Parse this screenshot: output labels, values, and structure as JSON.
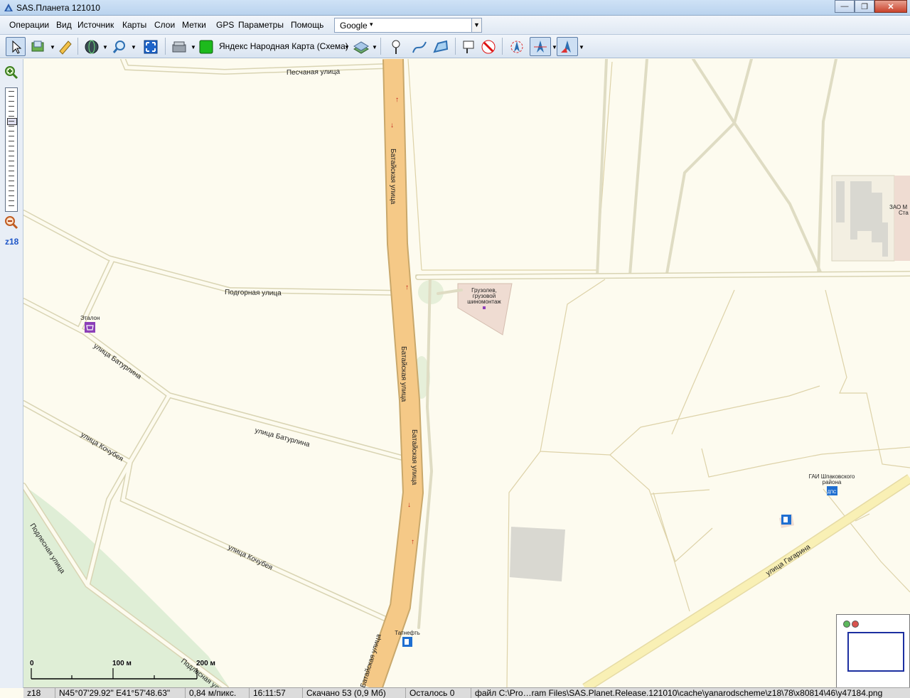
{
  "window": {
    "title": "SAS.Планета 121010",
    "btn_minimize": "—",
    "btn_maximize": "❐",
    "btn_close": "✕"
  },
  "menu": {
    "items": [
      "Операции",
      "Вид",
      "Источник",
      "Карты",
      "Слои",
      "Метки",
      "GPS",
      "Параметры",
      "Помощь"
    ],
    "search_provider": "Google",
    "search_value": ""
  },
  "toolbar": {
    "map_name": "Яндекс Народная Карта (Схема)",
    "icons": [
      "pointer-icon",
      "layers-icon",
      "ruler-icon",
      "globe-icon",
      "zoom-tool-icon",
      "fullscreen-icon",
      "gps-device-icon",
      "map-source-icon",
      "layers-overlay-icon",
      "placemark-icon",
      "path-icon",
      "polygon-icon",
      "marks-list-icon",
      "no-marks-icon",
      "gps-track-icon",
      "gps-center-icon",
      "gps-follow-icon"
    ]
  },
  "zoom": {
    "level_label": "z18"
  },
  "map": {
    "streets": {
      "pesch": "Песчаная улица",
      "podgor": "Подгорная улица",
      "batur1": "улица Батурлина",
      "batur2": "улица Батурлина",
      "koch1": "улица Кочубея",
      "koch2": "улица Кочубея",
      "podles": "Подлесная улица",
      "podles2": "Подлесная улица",
      "bat1": "Батайская улица",
      "bat2": "Батайская улица",
      "bat3": "Батайская улица",
      "bat4": "Батайская улица",
      "gagarin": "улица Гагарина"
    },
    "pois": {
      "etalon": "Эталон",
      "gruz1": "Грузолев,",
      "gruz2": "грузовой",
      "gruz3": "шиномонтаж",
      "gai1": "ГАИ Шпаковского",
      "gai2": "района",
      "gai_badge": "ДПС",
      "tatneft": "Татнефть",
      "zao1": "ЗАО М",
      "zao2": "Ста"
    },
    "scale": {
      "zero": "0",
      "mid": "100 м",
      "end": "200 м"
    }
  },
  "status": {
    "zoom": "z18",
    "coords": "N45°07'29.92\" E41°57'48.63\"",
    "resolution": "0,84 м/пикс.",
    "time": "16:11:57",
    "downloaded": "Скачано 53 (0,9 Мб)",
    "remaining": "Осталось 0",
    "file": "файл C:\\Pro…ram Files\\SAS.Planet.Release.121010\\cache\\yanarodscheme\\z18\\78\\x80814\\46\\y47184.png"
  },
  "colors": {
    "background": "#fdfbef",
    "main_road": "#f5c987",
    "road_outline": "#d9d4b3",
    "building": "#dcdcdc",
    "poi_area": "#efdcd2"
  }
}
